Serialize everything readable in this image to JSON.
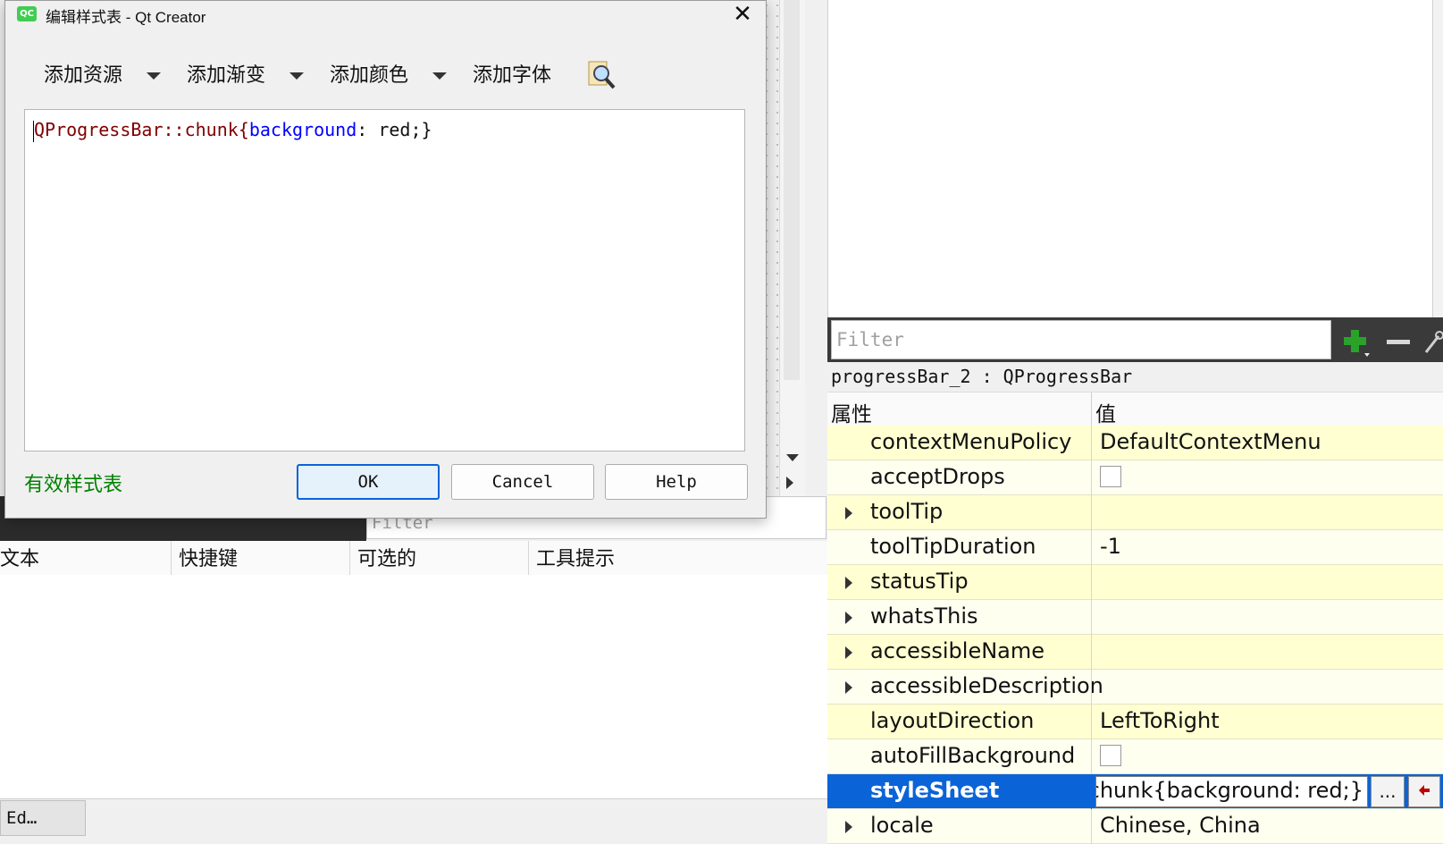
{
  "dialog": {
    "title": "编辑样式表 - Qt Creator",
    "app_icon_text": "QC",
    "close_glyph": "✕",
    "toolbar": {
      "add_resource": "添加资源",
      "add_gradient": "添加渐变",
      "add_color": "添加颜色",
      "add_font": "添加字体"
    },
    "stylesheet": {
      "selector": "QProgressBar::chunk{",
      "property": "background",
      "colon": ": ",
      "value": "red;}"
    },
    "status": "有效样式表",
    "buttons": {
      "ok": "OK",
      "cancel": "Cancel",
      "help": "Help"
    },
    "status_color": "#008000"
  },
  "action_editor": {
    "filter_placeholder": "Filter",
    "columns": [
      "文本",
      "快捷键",
      "可选的",
      "工具提示"
    ],
    "bottom_tab": "Ed…"
  },
  "property_editor": {
    "filter_placeholder": "Filter",
    "object_label": "progressBar_2 : QProgressBar",
    "header": {
      "property": "属性",
      "value": "值"
    },
    "rows": [
      {
        "name": "contextMenuPolicy",
        "value": "DefaultContextMenu"
      },
      {
        "name": "acceptDrops",
        "value": ""
      },
      {
        "name": "toolTip",
        "value": ""
      },
      {
        "name": "toolTipDuration",
        "value": "-1"
      },
      {
        "name": "statusTip",
        "value": ""
      },
      {
        "name": "whatsThis",
        "value": ""
      },
      {
        "name": "accessibleName",
        "value": ""
      },
      {
        "name": "accessibleDescription",
        "value": ""
      },
      {
        "name": "layoutDirection",
        "value": "LeftToRight"
      },
      {
        "name": "autoFillBackground",
        "value": ""
      },
      {
        "name": "styleSheet",
        "value": "r::chunk{background: red;}"
      },
      {
        "name": "locale",
        "value": "Chinese, China"
      }
    ],
    "stylesheet_more": "...",
    "selected_color": "#0a64d8",
    "row_colors": [
      "#ffffd2",
      "#fffff0"
    ]
  }
}
